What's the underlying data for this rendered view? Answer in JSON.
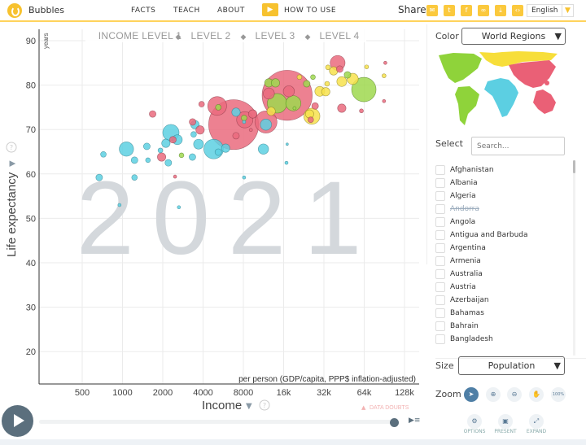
{
  "header": {
    "app_name": "Bubbles",
    "nav": [
      "FACTS",
      "TEACH",
      "ABOUT"
    ],
    "how_to_use": "HOW TO USE",
    "share_label": "Share",
    "share_icons": [
      "email-icon",
      "twitter-icon",
      "facebook-icon",
      "link-icon",
      "download-icon",
      "embed-icon"
    ],
    "language": "English"
  },
  "chart": {
    "income_levels": [
      "INCOME LEVEL 1",
      "LEVEL 2",
      "LEVEL 3",
      "LEVEL 4"
    ],
    "year": "2021",
    "y_unit": "years",
    "y_label": "Life expectancy",
    "x_label": "Income",
    "x_sublabel": "per person (GDP/capita, PPP$ inflation-adjusted)",
    "data_doubts": "DATA DOUBTS"
  },
  "chart_data": {
    "type": "scatter",
    "xscale": "log",
    "xlim": [
      238,
      164000
    ],
    "ylim": [
      15.5,
      90.5
    ],
    "x_ticks": [
      500,
      1000,
      2000,
      4000,
      8000,
      16000,
      32000,
      64000,
      128000
    ],
    "x_tick_labels": [
      "500",
      "1000",
      "2000",
      "4000",
      "8000",
      "16k",
      "32k",
      "64k",
      "128k"
    ],
    "y_ticks": [
      20,
      30,
      40,
      50,
      60,
      70,
      80,
      90
    ],
    "y_tick_labels": [
      "20",
      "30",
      "40",
      "50",
      "60",
      "70",
      "80",
      "90"
    ],
    "grid": true,
    "region_colors": {
      "asia": "#ea6b7e",
      "americas": "#9fd84f",
      "africa": "#5dd0e2",
      "europe": "#f7e24e"
    },
    "bubbles": [
      {
        "income": 17000,
        "life": 77.7,
        "pop": 1410,
        "region": "asia"
      },
      {
        "income": 6770,
        "life": 71.1,
        "pop": 1400,
        "region": "asia"
      },
      {
        "income": 63600,
        "life": 79,
        "pop": 335,
        "region": "americas"
      },
      {
        "income": 11800,
        "life": 71.7,
        "pop": 275,
        "region": "asia"
      },
      {
        "income": 4800,
        "life": 65.6,
        "pop": 215,
        "region": "africa"
      },
      {
        "income": 5100,
        "life": 75.3,
        "pop": 200,
        "region": "asia"
      },
      {
        "income": 8200,
        "life": 72.2,
        "pop": 150,
        "region": "asia"
      },
      {
        "income": 2300,
        "life": 69.3,
        "pop": 150,
        "region": "africa"
      },
      {
        "income": 40500,
        "life": 85,
        "pop": 125,
        "region": "asia"
      },
      {
        "income": 26000,
        "life": 73,
        "pop": 145,
        "region": "europe"
      },
      {
        "income": 14300,
        "life": 75.9,
        "pop": 215,
        "region": "americas"
      },
      {
        "income": 18900,
        "life": 75.9,
        "pop": 130,
        "region": "americas"
      },
      {
        "income": 11300,
        "life": 65.6,
        "pop": 60,
        "region": "africa"
      },
      {
        "income": 1070,
        "life": 65.6,
        "pop": 115,
        "region": "africa"
      },
      {
        "income": 11800,
        "life": 71.1,
        "pop": 70,
        "region": "africa"
      },
      {
        "income": 1680,
        "life": 73.5,
        "pop": 25,
        "region": "asia"
      },
      {
        "income": 720,
        "life": 64.4,
        "pop": 18,
        "region": "africa"
      },
      {
        "income": 37800,
        "life": 83.2,
        "pop": 40,
        "region": "europe"
      },
      {
        "income": 52500,
        "life": 81.4,
        "pop": 70,
        "region": "europe"
      },
      {
        "income": 43500,
        "life": 80.8,
        "pop": 55,
        "region": "europe"
      },
      {
        "income": 12400,
        "life": 80.5,
        "pop": 40,
        "region": "americas"
      },
      {
        "income": 13900,
        "life": 80.5,
        "pop": 40,
        "region": "americas"
      },
      {
        "income": 12400,
        "life": 78.1,
        "pop": 70,
        "region": "asia"
      },
      {
        "income": 43500,
        "life": 74.8,
        "pop": 40,
        "region": "asia"
      },
      {
        "income": 92000,
        "life": 85,
        "pop": 6,
        "region": "asia"
      },
      {
        "income": 66700,
        "life": 84.1,
        "pop": 9,
        "region": "europe"
      },
      {
        "income": 90000,
        "life": 82.1,
        "pop": 9,
        "region": "europe"
      },
      {
        "income": 23800,
        "life": 80.3,
        "pop": 25,
        "region": "americas"
      },
      {
        "income": 7050,
        "life": 73.9,
        "pop": 40,
        "region": "africa"
      },
      {
        "income": 3480,
        "life": 71.1,
        "pop": 40,
        "region": "africa"
      },
      {
        "income": 3340,
        "life": 71.7,
        "pop": 25,
        "region": "asia"
      },
      {
        "income": 3900,
        "life": 75.7,
        "pop": 18,
        "region": "asia"
      },
      {
        "income": 2110,
        "life": 66.9,
        "pop": 40,
        "region": "africa"
      },
      {
        "income": 2570,
        "life": 67.7,
        "pop": 55,
        "region": "africa"
      },
      {
        "income": 2380,
        "life": 67.7,
        "pop": 25,
        "region": "asia"
      },
      {
        "income": 1520,
        "life": 66.2,
        "pop": 25,
        "region": "africa"
      },
      {
        "income": 1960,
        "life": 63.8,
        "pop": 40,
        "region": "asia"
      },
      {
        "income": 1230,
        "life": 63.1,
        "pop": 25,
        "region": "africa"
      },
      {
        "income": 2200,
        "life": 62.5,
        "pop": 25,
        "region": "africa"
      },
      {
        "income": 3330,
        "life": 63.8,
        "pop": 25,
        "region": "africa"
      },
      {
        "income": 3400,
        "life": 68.9,
        "pop": 18,
        "region": "africa"
      },
      {
        "income": 2760,
        "life": 64.2,
        "pop": 13,
        "region": "americas"
      },
      {
        "income": 3700,
        "life": 66.7,
        "pop": 55,
        "region": "africa"
      },
      {
        "income": 5900,
        "life": 65.8,
        "pop": 40,
        "region": "africa"
      },
      {
        "income": 5200,
        "life": 64.9,
        "pop": 25,
        "region": "africa"
      },
      {
        "income": 3800,
        "life": 69.9,
        "pop": 40,
        "region": "asia"
      },
      {
        "income": 7050,
        "life": 68.6,
        "pop": 25,
        "region": "asia"
      },
      {
        "income": 9400,
        "life": 73.5,
        "pop": 40,
        "region": "asia"
      },
      {
        "income": 17500,
        "life": 78.6,
        "pop": 70,
        "region": "asia"
      },
      {
        "income": 8100,
        "life": 72.6,
        "pop": 18,
        "region": "americas"
      },
      {
        "income": 5200,
        "life": 75,
        "pop": 18,
        "region": "americas"
      },
      {
        "income": 12900,
        "life": 74.1,
        "pop": 40,
        "region": "europe"
      },
      {
        "income": 29800,
        "life": 78.6,
        "pop": 55,
        "region": "europe"
      },
      {
        "income": 33000,
        "life": 78.5,
        "pop": 40,
        "region": "europe"
      },
      {
        "income": 25000,
        "life": 73.5,
        "pop": 40,
        "region": "europe"
      },
      {
        "income": 27500,
        "life": 75.3,
        "pop": 25,
        "region": "asia"
      },
      {
        "income": 25500,
        "life": 72.2,
        "pop": 18,
        "region": "asia"
      },
      {
        "income": 48000,
        "life": 82.3,
        "pop": 25,
        "region": "americas"
      },
      {
        "income": 42000,
        "life": 83.6,
        "pop": 25,
        "region": "asia"
      },
      {
        "income": 33800,
        "life": 80.3,
        "pop": 13,
        "region": "europe"
      },
      {
        "income": 90000,
        "life": 76.4,
        "pop": 6,
        "region": "asia"
      },
      {
        "income": 61000,
        "life": 74.2,
        "pop": 9,
        "region": "asia"
      },
      {
        "income": 670,
        "life": 59.2,
        "pop": 25,
        "region": "africa"
      },
      {
        "income": 1230,
        "life": 59.2,
        "pop": 18,
        "region": "africa"
      },
      {
        "income": 950,
        "life": 53,
        "pop": 6,
        "region": "africa"
      },
      {
        "income": 2470,
        "life": 59.4,
        "pop": 6,
        "region": "asia"
      },
      {
        "income": 2640,
        "life": 52.5,
        "pop": 6,
        "region": "africa"
      },
      {
        "income": 8100,
        "life": 59.2,
        "pop": 6,
        "region": "africa"
      },
      {
        "income": 16800,
        "life": 62.5,
        "pop": 6,
        "region": "africa"
      },
      {
        "income": 17000,
        "life": 66.7,
        "pop": 3,
        "region": "africa"
      },
      {
        "income": 19300,
        "life": 74.8,
        "pop": 6,
        "region": "americas"
      },
      {
        "income": 1550,
        "life": 63.1,
        "pop": 13,
        "region": "africa"
      },
      {
        "income": 1920,
        "life": 65.3,
        "pop": 13,
        "region": "africa"
      },
      {
        "income": 9100,
        "life": 69.9,
        "pop": 6,
        "region": "asia"
      },
      {
        "income": 8100,
        "life": 71.7,
        "pop": 6,
        "region": "africa"
      },
      {
        "income": 21000,
        "life": 81.8,
        "pop": 13,
        "region": "europe"
      },
      {
        "income": 34300,
        "life": 84,
        "pop": 13,
        "region": "europe"
      },
      {
        "income": 26500,
        "life": 81.8,
        "pop": 13,
        "region": "americas"
      }
    ]
  },
  "timeline": {
    "progress": 1.0
  },
  "panel": {
    "color_label": "Color",
    "color_value": "World Regions",
    "select_label": "Select",
    "search_placeholder": "Search...",
    "countries": [
      "Afghanistan",
      "Albania",
      "Algeria",
      "Andorra",
      "Angola",
      "Antigua and Barbuda",
      "Argentina",
      "Armenia",
      "Australia",
      "Austria",
      "Azerbaijan",
      "Bahamas",
      "Bahrain",
      "Bangladesh"
    ],
    "unavailable": [
      "Andorra"
    ],
    "size_label": "Size",
    "size_value": "Population",
    "zoom_label": "Zoom",
    "zoom_100": "100%",
    "options": "OPTIONS",
    "present": "PRESENT",
    "expand": "EXPAND"
  }
}
